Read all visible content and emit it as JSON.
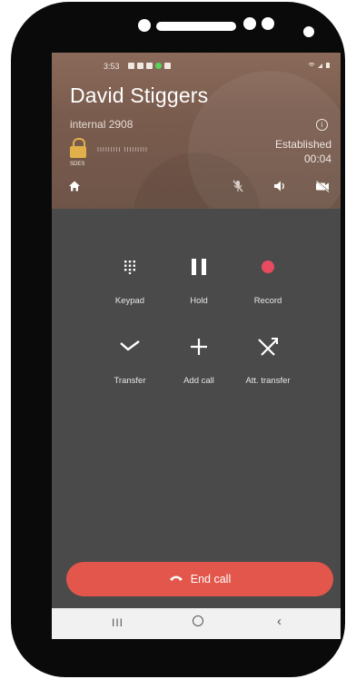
{
  "status_bar": {
    "time": "3:53",
    "right_icons": "wifi-signal-battery"
  },
  "call": {
    "caller_name": "David Stiggers",
    "number": "internal 2908",
    "state": "Established",
    "duration": "00:04",
    "encryption_label": "SDES",
    "sas_code": "IIIIIIIII IIIIIIIII"
  },
  "actions": [
    {
      "label": "Keypad",
      "icon": "keypad-icon"
    },
    {
      "label": "Hold",
      "icon": "pause-icon"
    },
    {
      "label": "Record",
      "icon": "record-icon"
    },
    {
      "label": "Transfer",
      "icon": "transfer-icon"
    },
    {
      "label": "Add call",
      "icon": "plus-icon"
    },
    {
      "label": "Att. transfer",
      "icon": "attended-transfer-icon"
    }
  ],
  "end_call_label": "End call",
  "colors": {
    "end_call": "#e3564b",
    "record_dot": "#e84a5f",
    "header": "#7a5c4e",
    "background": "#4a4a4a"
  }
}
